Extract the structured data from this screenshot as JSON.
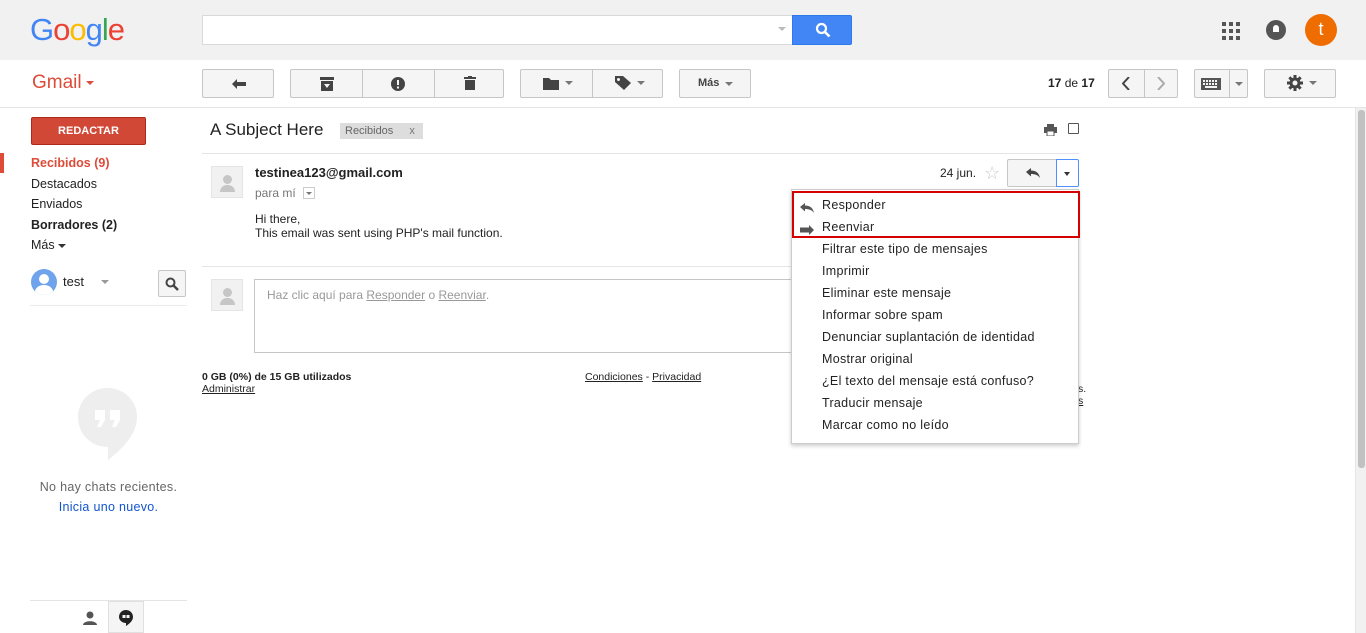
{
  "header": {
    "logo": "Google",
    "logo_colors": [
      "#4285f4",
      "#ea4335",
      "#fbbc05",
      "#4285f4",
      "#34a853",
      "#ea4335"
    ],
    "search_placeholder": "",
    "avatar_letter": "t",
    "avatar_color": "#ef6c00"
  },
  "toolbar": {
    "app_name": "Gmail",
    "more_label": "Más",
    "page_current": "17",
    "page_sep": "de",
    "page_total": "17"
  },
  "sidebar": {
    "compose_label": "REDACTAR",
    "items": [
      {
        "label": "Recibidos (9)",
        "active": true
      },
      {
        "label": "Destacados"
      },
      {
        "label": "Enviados"
      },
      {
        "label": "Borradores (2)",
        "bold": true
      },
      {
        "label": "Más"
      }
    ],
    "user_name": "test",
    "no_chats": "No hay chats recientes.",
    "new_chat": "Inicia uno nuevo."
  },
  "message": {
    "subject": "A Subject Here",
    "label": "Recibidos",
    "label_remove": "x",
    "sender": "testinea123@gmail.com",
    "to": "para mí",
    "date": "24 jun.",
    "body_line1": "Hi there,",
    "body_line2": "This email was sent using PHP's mail function.",
    "reply_hint_prefix": "Haz clic aquí para ",
    "reply_link": "Responder",
    "reply_hint_mid": " o ",
    "forward_link": "Reenviar",
    "reply_hint_suffix": "."
  },
  "footer": {
    "storage": "0 GB (0%) de 15 GB utilizados",
    "admin": "Administrar",
    "terms": "Condiciones",
    "terms_sep": " - ",
    "privacy": "Privacidad",
    "frag1": "s.",
    "frag2": "s"
  },
  "menu": {
    "items": [
      {
        "label": "Responder",
        "icon": "reply-icon"
      },
      {
        "label": "Reenviar",
        "icon": "forward-icon"
      },
      {
        "label": "Filtrar este tipo de mensajes"
      },
      {
        "label": "Imprimir"
      },
      {
        "label": "Eliminar este mensaje"
      },
      {
        "label": "Informar sobre spam"
      },
      {
        "label": "Denunciar suplantación de identidad"
      },
      {
        "label": "Mostrar original"
      },
      {
        "label": "¿El texto del mensaje está confuso?"
      },
      {
        "label": "Traducir mensaje"
      },
      {
        "label": "Marcar como no leído"
      }
    ],
    "highlight_color": "#d50000"
  },
  "colors": {
    "accent": "#dd4b39",
    "compose": "#d14836",
    "search": "#4285f4",
    "link": "#1155cc"
  }
}
